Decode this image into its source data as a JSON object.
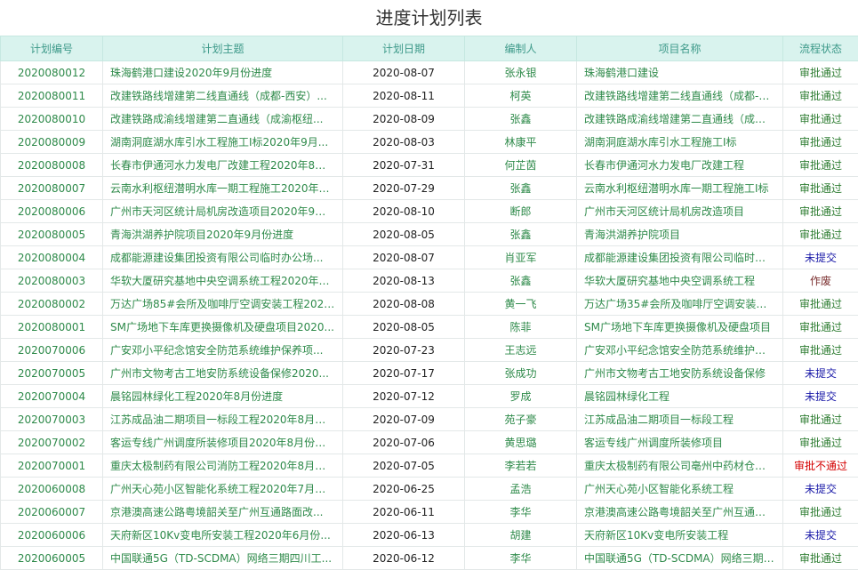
{
  "title": "进度计划列表",
  "columns": [
    "计划编号",
    "计划主题",
    "计划日期",
    "编制人",
    "项目名称",
    "流程状态"
  ],
  "status_colors": {
    "审批通过": "#2e7d32",
    "未提交": "#1a1aa8",
    "作废": "#7a2e2e",
    "审批不通过": "#d40000"
  },
  "rows": [
    {
      "code": "2020080012",
      "subject": "珠海鹤港口建设2020年9月份进度",
      "date": "2020-08-07",
      "author": "张永银",
      "project": "珠海鹤港口建设",
      "status": "审批通过"
    },
    {
      "code": "2020080011",
      "subject": "改建铁路线增建第二线直通线（成都-西安）...",
      "date": "2020-08-11",
      "author": "柯英",
      "project": "改建铁路线增建第二线直通线（成都-西安）...",
      "status": "审批通过"
    },
    {
      "code": "2020080010",
      "subject": "改建铁路成渝线增建第二直通线（成渝枢纽...",
      "date": "2020-08-09",
      "author": "张鑫",
      "project": "改建铁路成渝线增建第二直通线（成渝枢纽...",
      "status": "审批通过"
    },
    {
      "code": "2020080009",
      "subject": "湖南洞庭湖水库引水工程施工Ⅰ标2020年9月...",
      "date": "2020-08-03",
      "author": "林康平",
      "project": "湖南洞庭湖水库引水工程施工Ⅰ标",
      "status": "审批通过"
    },
    {
      "code": "2020080008",
      "subject": "长春市伊通河水力发电厂改建工程2020年8月...",
      "date": "2020-07-31",
      "author": "何芷茵",
      "project": "长春市伊通河水力发电厂改建工程",
      "status": "审批通过"
    },
    {
      "code": "2020080007",
      "subject": "云南水利枢纽潜明水库一期工程施工2020年8...",
      "date": "2020-07-29",
      "author": "张鑫",
      "project": "云南水利枢纽潜明水库一期工程施工Ⅰ标",
      "status": "审批通过"
    },
    {
      "code": "2020080006",
      "subject": "广州市天河区统计局机房改造项目2020年9月...",
      "date": "2020-08-10",
      "author": "断郎",
      "project": "广州市天河区统计局机房改造项目",
      "status": "审批通过"
    },
    {
      "code": "2020080005",
      "subject": "青海洪湖养护院项目2020年9月份进度",
      "date": "2020-08-05",
      "author": "张鑫",
      "project": "青海洪湖养护院项目",
      "status": "审批通过"
    },
    {
      "code": "2020080004",
      "subject": "成都能源建设集团投资有限公司临时办公场...",
      "date": "2020-08-07",
      "author": "肖亚军",
      "project": "成都能源建设集团投资有限公司临时办公场...",
      "status": "未提交"
    },
    {
      "code": "2020080003",
      "subject": "华软大厦研究基地中央空调系统工程2020年9...",
      "date": "2020-08-13",
      "author": "张鑫",
      "project": "华软大厦研究基地中央空调系统工程",
      "status": "作废"
    },
    {
      "code": "2020080002",
      "subject": "万达广场85#会所及咖啡厅空调安装工程2020...",
      "date": "2020-08-08",
      "author": "黄一飞",
      "project": "万达广场35#会所及咖啡厅空调安装工程",
      "status": "审批通过"
    },
    {
      "code": "2020080001",
      "subject": "SM广场地下车库更换摄像机及硬盘项目2020...",
      "date": "2020-08-05",
      "author": "陈菲",
      "project": "SM广场地下车库更换摄像机及硬盘项目",
      "status": "审批通过"
    },
    {
      "code": "2020070006",
      "subject": "广安邓小平纪念馆安全防范系统维护保养项...",
      "date": "2020-07-23",
      "author": "王志远",
      "project": "广安邓小平纪念馆安全防范系统维护保养项目",
      "status": "审批通过"
    },
    {
      "code": "2020070005",
      "subject": "广州市文物考古工地安防系统设备保修2020...",
      "date": "2020-07-17",
      "author": "张成功",
      "project": "广州市文物考古工地安防系统设备保修",
      "status": "未提交"
    },
    {
      "code": "2020070004",
      "subject": "晨铭园林绿化工程2020年8月份进度",
      "date": "2020-07-12",
      "author": "罗成",
      "project": "晨铭园林绿化工程",
      "status": "未提交"
    },
    {
      "code": "2020070003",
      "subject": "江苏成品油二期项目一标段工程2020年8月份...",
      "date": "2020-07-09",
      "author": "苑子豪",
      "project": "江苏成品油二期项目一标段工程",
      "status": "审批通过"
    },
    {
      "code": "2020070002",
      "subject": "客运专线广州调度所装修项目2020年8月份进度",
      "date": "2020-07-06",
      "author": "黄思璐",
      "project": "客运专线广州调度所装修项目",
      "status": "审批通过"
    },
    {
      "code": "2020070001",
      "subject": "重庆太极制药有限公司消防工程2020年8月份...",
      "date": "2020-07-05",
      "author": "李若若",
      "project": "重庆太极制药有限公司亳州中药材仓储物流...",
      "status": "审批不通过"
    },
    {
      "code": "2020060008",
      "subject": "广州天心苑小区智能化系统工程2020年7月份...",
      "date": "2020-06-25",
      "author": "孟浩",
      "project": "广州天心苑小区智能化系统工程",
      "status": "未提交"
    },
    {
      "code": "2020060007",
      "subject": "京港澳高速公路粤境韶关至广州互通路面改...",
      "date": "2020-06-11",
      "author": "李华",
      "project": "京港澳高速公路粤境韶关至广州互通路面改...",
      "status": "审批通过"
    },
    {
      "code": "2020060006",
      "subject": "天府新区10Kv变电所安装工程2020年6月份...",
      "date": "2020-06-13",
      "author": "胡建",
      "project": "天府新区10Kv变电所安装工程",
      "status": "未提交"
    },
    {
      "code": "2020060005",
      "subject": "中国联通5G（TD-SCDMA）网络三期四川工...",
      "date": "2020-06-12",
      "author": "李华",
      "project": "中国联通5G（TD-SCDMA）网络三期四川工程",
      "status": "审批通过"
    }
  ]
}
